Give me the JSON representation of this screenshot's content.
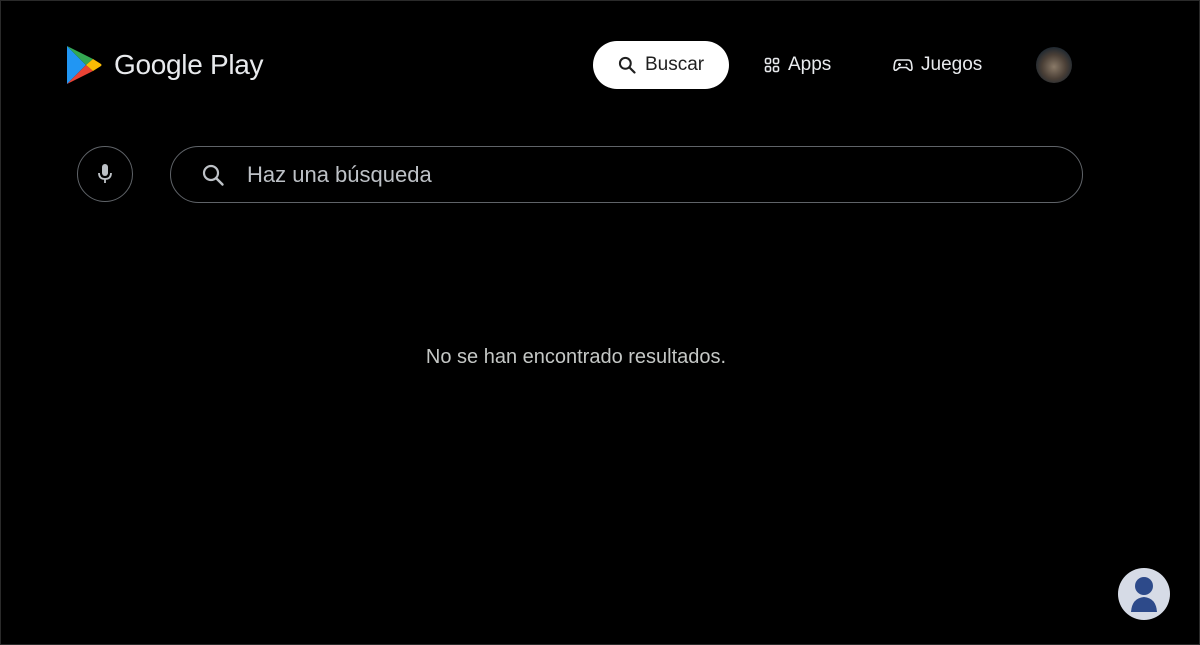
{
  "header": {
    "brand": "Google Play",
    "nav": {
      "search_label": "Buscar",
      "apps_label": "Apps",
      "games_label": "Juegos"
    },
    "icons": {
      "logo": "google-play-logo",
      "search": "search-icon",
      "apps": "apps-grid-icon",
      "games": "gamepad-icon",
      "avatar": "user-avatar"
    }
  },
  "search": {
    "placeholder": "Haz una búsqueda",
    "value": "",
    "mic_icon": "microphone-icon"
  },
  "results": {
    "empty_message": "No se han encontrado resultados."
  },
  "colors": {
    "background": "#000000",
    "active_tab_bg": "#ffffff",
    "border": "#5f6368"
  }
}
